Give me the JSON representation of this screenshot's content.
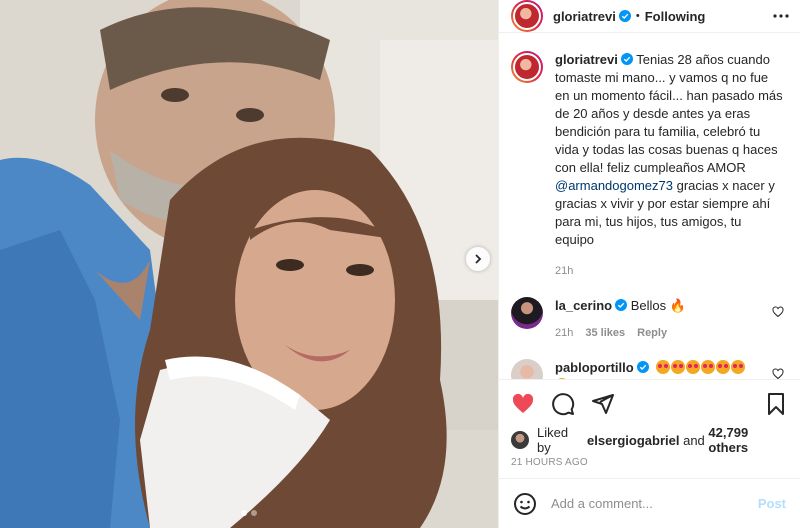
{
  "post": {
    "author": "gloriatrevi",
    "follow_status": "Following",
    "separator": "•",
    "caption_author": "gloriatrevi",
    "caption_text_1": " Tenias 28 años cuando tomaste mi mano... y vamos q no fue en un momento fácil... han pasado más de 20 años y desde antes ya eras bendición para tu familia, celebró tu vida y todas las cosas buenas q haces con ella! feliz cumpleaños AMOR ",
    "caption_mention": "@armandogomez73",
    "caption_text_2": " gracias x nacer y gracias x vivir y por estar siempre ahí para mi, tus hijos, tus amigos, tu equipo",
    "caption_time": "21h",
    "carousel": {
      "count": 2,
      "active_index": 0
    }
  },
  "comments": [
    {
      "user": "la_cerino",
      "text": "Bellos 🔥",
      "time": "21h",
      "likes": "35 likes",
      "reply": "Reply"
    },
    {
      "user": "pabloportillo",
      "text": "",
      "emoji_count": 7,
      "time": "",
      "likes": "",
      "reply": ""
    }
  ],
  "likes": {
    "prefix": "Liked by ",
    "user": "elsergiogabriel",
    "middle": " and ",
    "count": "42,799 others"
  },
  "posted_ago": "21 HOURS AGO",
  "add_comment": {
    "placeholder": "Add a comment...",
    "post_label": "Post"
  },
  "icons": {
    "verified": "verified-badge-icon",
    "more": "more-options-icon",
    "next": "chevron-right-icon",
    "like": "heart-filled-icon",
    "comment": "comment-icon",
    "share": "share-icon",
    "save": "bookmark-icon",
    "emoji": "emoji-icon"
  },
  "colors": {
    "accent_blue": "#0095f6",
    "verified_blue": "#0095f6",
    "like_red": "#ed4956",
    "mention": "#00376b",
    "post_disabled": "#b2dffc"
  }
}
